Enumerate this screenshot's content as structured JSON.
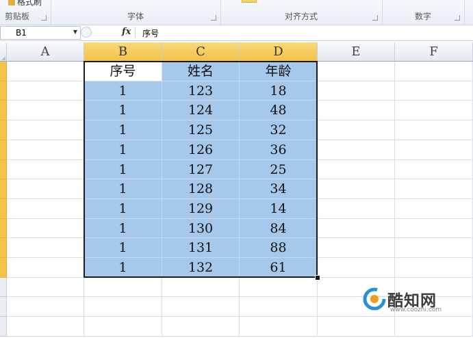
{
  "ribbon": {
    "format_painter": "格式刷",
    "groups": [
      {
        "label": "剪贴板"
      },
      {
        "label": "字体"
      },
      {
        "label": "对齐方式"
      },
      {
        "label": "数字"
      }
    ]
  },
  "formula_bar": {
    "name_box": "B1",
    "fx": "fx",
    "content": "序号"
  },
  "columns": [
    "A",
    "B",
    "C",
    "D",
    "E",
    "F"
  ],
  "table": {
    "header": [
      "序号",
      "姓名",
      "年龄"
    ],
    "rows": [
      [
        "1",
        "123",
        "18"
      ],
      [
        "1",
        "124",
        "48"
      ],
      [
        "1",
        "125",
        "32"
      ],
      [
        "1",
        "126",
        "36"
      ],
      [
        "1",
        "127",
        "25"
      ],
      [
        "1",
        "128",
        "34"
      ],
      [
        "1",
        "129",
        "14"
      ],
      [
        "1",
        "130",
        "84"
      ],
      [
        "1",
        "131",
        "88"
      ],
      [
        "1",
        "132",
        "61"
      ]
    ]
  },
  "colors": {
    "selection_fill": "#a6c8ea",
    "selected_header": "#f3c247"
  },
  "watermark": {
    "name": "酷知网",
    "url": "www.coozhi.com"
  }
}
